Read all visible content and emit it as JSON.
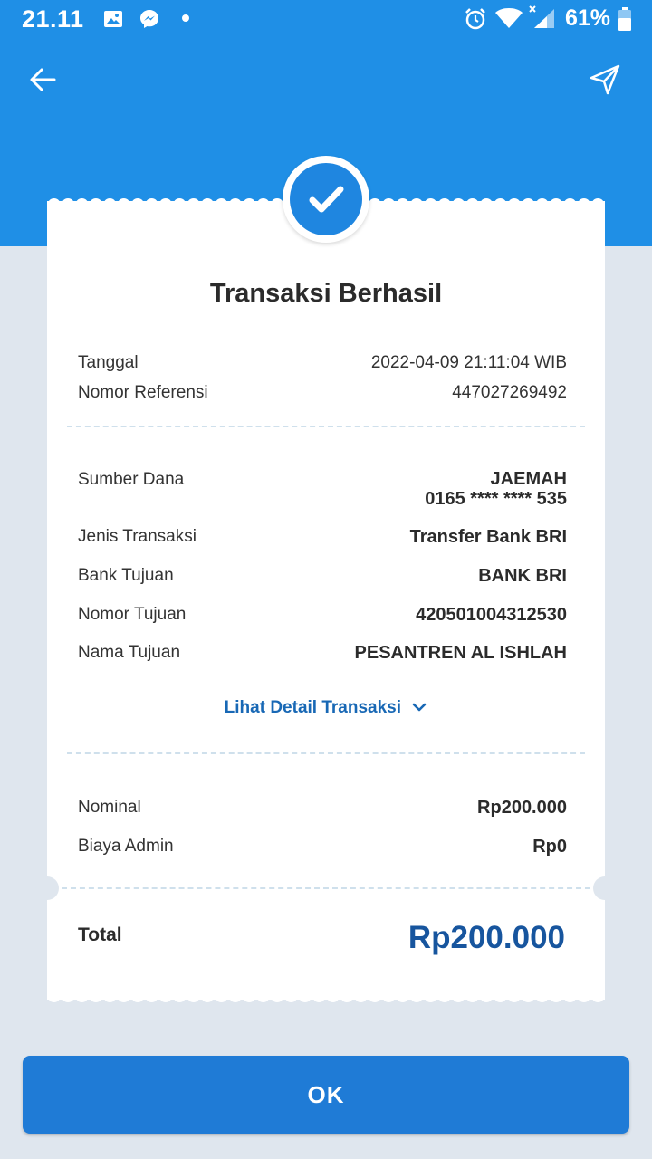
{
  "status_bar": {
    "time": "21.11",
    "battery": "61%",
    "icons": [
      "gallery-icon",
      "messenger-icon",
      "dot-icon",
      "alarm-icon",
      "wifi-icon",
      "signal-icon",
      "battery-icon"
    ]
  },
  "topbar": {
    "back_icon": "arrow-left-icon",
    "share_icon": "send-icon"
  },
  "receipt": {
    "status_icon": "check-icon",
    "title": "Transaksi Berhasil",
    "info": [
      {
        "label": "Tanggal",
        "value": "2022-04-09 21:11:04 WIB"
      },
      {
        "label": "Nomor Referensi",
        "value": "447027269492"
      }
    ],
    "details": {
      "sumber_dana_label": "Sumber Dana",
      "sumber_dana_name": "JAEMAH",
      "sumber_dana_account": "0165 **** **** 535",
      "rows": [
        {
          "label": "Jenis Transaksi",
          "value": "Transfer Bank BRI"
        },
        {
          "label": "Bank Tujuan",
          "value": "BANK BRI"
        },
        {
          "label": "Nomor Tujuan",
          "value": "420501004312530"
        },
        {
          "label": "Nama Tujuan",
          "value": "PESANTREN AL ISHLAH"
        }
      ],
      "detail_link": "Lihat Detail Transaksi"
    },
    "amounts": [
      {
        "label": "Nominal",
        "value": "Rp200.000"
      },
      {
        "label": "Biaya Admin",
        "value": "Rp0"
      }
    ],
    "total_label": "Total",
    "total_value": "Rp200.000"
  },
  "ok_button": "OK",
  "colors": {
    "header": "#1f8fe6",
    "accent": "#1f7bd6",
    "total": "#17559e",
    "link": "#1868b5",
    "background": "#dfe6ee"
  }
}
